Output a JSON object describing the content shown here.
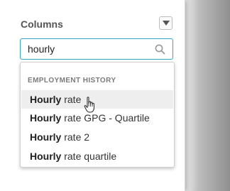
{
  "panel": {
    "title": "Columns",
    "collapse_icon": "triangle-down-icon"
  },
  "search": {
    "value": "hourly",
    "icon": "search-icon"
  },
  "dropdown": {
    "group_label": "EMPLOYMENT HISTORY",
    "options": [
      {
        "match": "Hourly",
        "rest": " rate",
        "hovered": true
      },
      {
        "match": "Hourly",
        "rest": " rate GPG - Quartile",
        "hovered": false
      },
      {
        "match": "Hourly",
        "rest": " rate 2",
        "hovered": false
      },
      {
        "match": "Hourly",
        "rest": " rate quartile",
        "hovered": false
      }
    ]
  },
  "colors": {
    "accent": "#2aa7c9",
    "hover_bg": "#eeeeee"
  }
}
